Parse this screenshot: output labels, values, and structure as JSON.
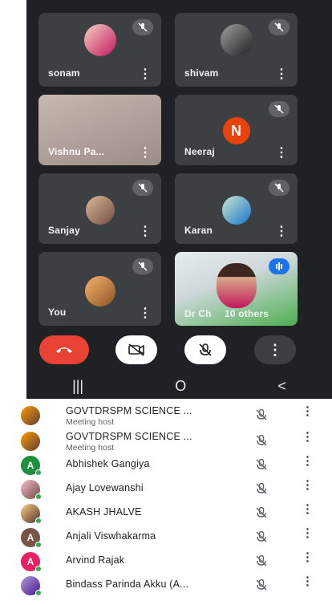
{
  "meeting": {
    "tiles": [
      {
        "name": "sonam",
        "muted": true,
        "avatar": "photo"
      },
      {
        "name": "shivam",
        "muted": true,
        "avatar": "photo"
      },
      {
        "name": "Vishnu Pa...",
        "muted": false,
        "avatar": "video"
      },
      {
        "name": "Neeraj",
        "muted": true,
        "avatar": "letter",
        "letter": "N",
        "color": "#e8430e"
      },
      {
        "name": "Sanjay",
        "muted": true,
        "avatar": "photo"
      },
      {
        "name": "Karan",
        "muted": true,
        "avatar": "photo"
      },
      {
        "name": "You",
        "muted": true,
        "avatar": "photo"
      },
      {
        "name": "Dr Ch",
        "others": "10 others",
        "avatar": "video"
      }
    ],
    "controls": [
      "end-call",
      "camera-off",
      "mic-off",
      "more"
    ],
    "colors": {
      "end_call": "#ea4335",
      "surface": "#202124",
      "tile": "#3c4043"
    }
  },
  "navbar": [
    "|||",
    "O",
    "<"
  ],
  "participants": [
    {
      "name": "GOVTDRSPM SCIENCE ...",
      "role": "Meeting host",
      "avatar": "photo"
    },
    {
      "name": "GOVTDRSPM SCIENCE ...",
      "role": "Meeting host",
      "avatar": "photo"
    },
    {
      "name": "Abhishek Gangiya",
      "role": "",
      "avatar": "letter",
      "letter": "A",
      "color": "#1e8e3e"
    },
    {
      "name": "Ajay Lovewanshi",
      "role": "",
      "avatar": "photo"
    },
    {
      "name": "AKASH JHALVE",
      "role": "",
      "avatar": "photo"
    },
    {
      "name": "Anjali Viswhakarma",
      "role": "",
      "avatar": "letter",
      "letter": "A",
      "color": "#795548"
    },
    {
      "name": "Arvind Rajak",
      "role": "",
      "avatar": "letter",
      "letter": "A",
      "color": "#e91e63"
    },
    {
      "name": "Bindass Parinda Akku (A...",
      "role": "",
      "avatar": "photo"
    }
  ]
}
